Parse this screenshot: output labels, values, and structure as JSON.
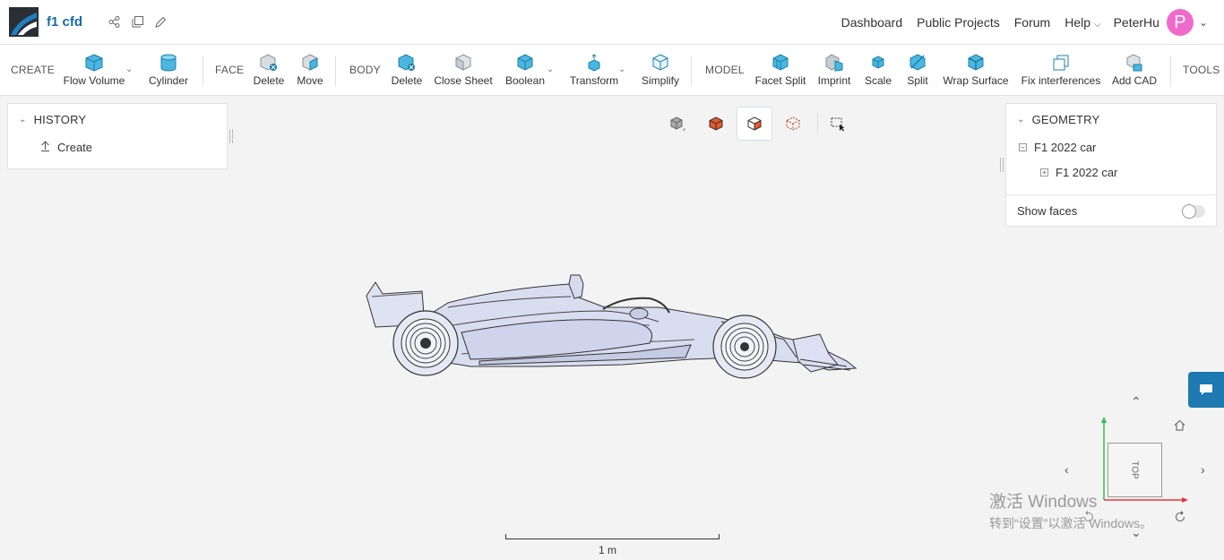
{
  "app": {
    "project_name": "f1 cfd",
    "brand_color": "#1a6aa8"
  },
  "top_nav": {
    "links": [
      "Dashboard",
      "Public Projects",
      "Forum",
      "Help"
    ],
    "user": "PeterHu",
    "avatar_letter": "P",
    "avatar_color": "#f06acb"
  },
  "toolbar": {
    "groups": {
      "create": "CREATE",
      "face": "FACE",
      "body": "BODY",
      "model": "MODEL",
      "tools": "TOOLS"
    },
    "create_items": [
      "Flow Volume",
      "Cylinder"
    ],
    "face_items": [
      "Delete",
      "Move"
    ],
    "body_items": [
      "Delete",
      "Close Sheet",
      "Boolean",
      "Transform",
      "Simplify"
    ],
    "model_items": [
      "Facet Split",
      "Imprint",
      "Scale",
      "Split",
      "Wrap Surface",
      "Fix interferences",
      "Add CAD"
    ]
  },
  "history": {
    "title": "HISTORY",
    "items": [
      "Create"
    ]
  },
  "geometry": {
    "title": "GEOMETRY",
    "root": "F1 2022 car",
    "child": "F1 2022 car",
    "show_faces_label": "Show faces",
    "show_faces_on": false
  },
  "viewport": {
    "scale_label": "1 m",
    "navcube_face": "TOP"
  },
  "watermark": {
    "line1": "激活 Windows",
    "line2": "转到“设置”以激活 Windows。"
  }
}
